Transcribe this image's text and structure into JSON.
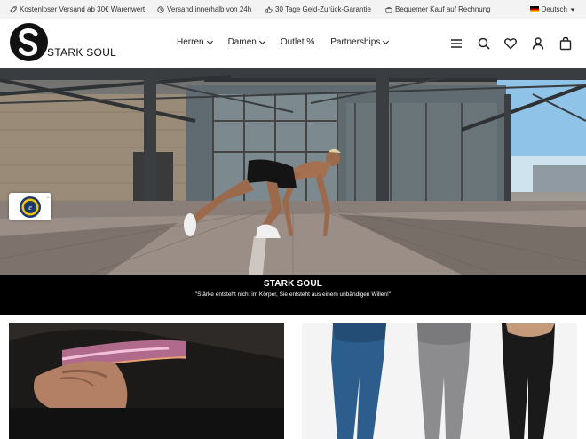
{
  "infobar": {
    "items": [
      {
        "icon": "truck-icon",
        "label": "Kostenloser Versand ab 30€ Warenwert"
      },
      {
        "icon": "clock-icon",
        "label": "Versand innerhalb von 24h"
      },
      {
        "icon": "thumbs-up-icon",
        "label": "30 Tage Geld-Zurück-Garantie"
      },
      {
        "icon": "briefcase-icon",
        "label": "Bequemer Kauf auf Rechnung"
      }
    ],
    "language": "Deutsch"
  },
  "header": {
    "logo_text": "STARK SOUL",
    "nav": [
      {
        "label": "Herren",
        "has_dropdown": true
      },
      {
        "label": "Damen",
        "has_dropdown": true
      },
      {
        "label": "Outlet %",
        "has_dropdown": false
      },
      {
        "label": "Partnerships",
        "has_dropdown": true
      }
    ],
    "icons": [
      "menu-icon",
      "search-icon",
      "heart-icon",
      "account-icon",
      "cart-icon"
    ]
  },
  "hero": {
    "title": "STARK SOUL",
    "subtitle": "\"Stärke entsteht nicht im Körper, Sie entsteht aus einem unbändigen Willen!\""
  },
  "colors": {
    "infobar_bg": "#f3f3f3",
    "caption_bg": "#000000",
    "text": "#222222"
  }
}
